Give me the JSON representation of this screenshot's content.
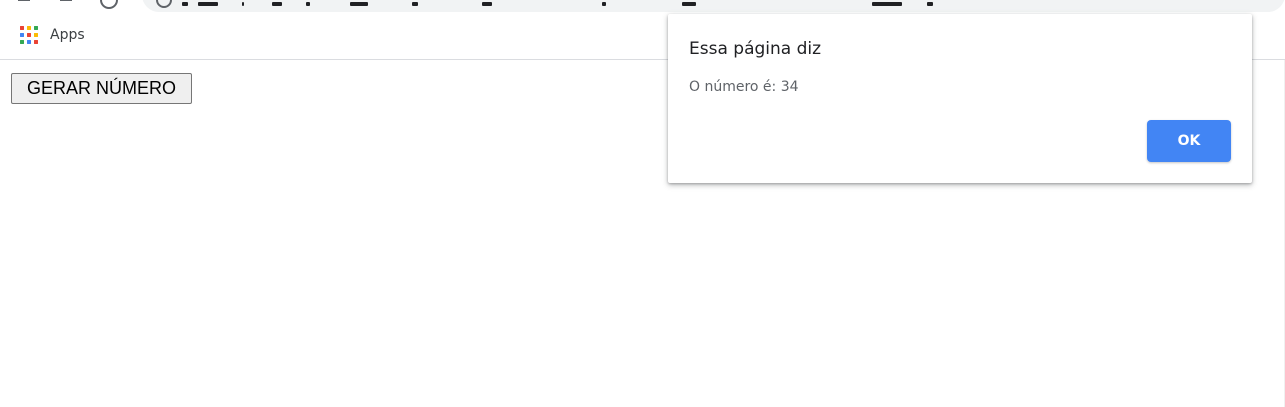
{
  "bookmarks_bar": {
    "apps_label": "Apps",
    "apps_icon_colors": [
      "#ea4335",
      "#fbbc05",
      "#34a853",
      "#4285f4",
      "#ea4335",
      "#fbbc05",
      "#34a853",
      "#4285f4",
      "#ea4335"
    ]
  },
  "page": {
    "button_label": "GERAR NÚMERO"
  },
  "dialog": {
    "title": "Essa página diz",
    "message": "O número é: 34",
    "ok_label": "OK",
    "accent_color": "#4285f4"
  },
  "icons": {
    "apps": "apps-grid-icon",
    "info": "info-icon",
    "back": "back-arrow-icon",
    "forward": "forward-arrow-icon",
    "reload": "reload-icon"
  }
}
